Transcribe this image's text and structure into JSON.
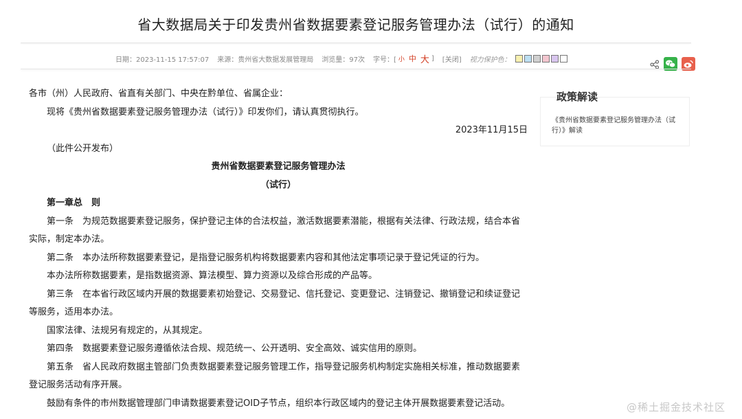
{
  "page": {
    "title": "省大数据局关于印发贵州省数据要素登记服务管理办法（试行）的通知"
  },
  "meta": {
    "date": "日期：2023-11-15 17:57:07",
    "source": "来源：贵州省大数据发展管理局",
    "views": "浏览量：97次",
    "font_size_label": "字号：[",
    "font_small": "小",
    "font_mid": "中",
    "font_big": "大",
    "font_close_bracket": "]",
    "close": "[关闭]",
    "vision_label": "视力保护色：",
    "swatch_colors": [
      "#f7f0b0",
      "#bcdff2",
      "#d0d0d0",
      "#f3c6cf",
      "#d9c6ef",
      "#ffffff"
    ]
  },
  "share": {
    "icons": [
      "share-icon",
      "wechat-icon",
      "weibo-icon"
    ],
    "colors": {
      "wechat": "#36b24a",
      "weibo": "#e8604c"
    }
  },
  "article": {
    "salutation": "各市（州）人民政府、省直有关部门、中央在黔单位、省属企业：",
    "intro": "现将《贵州省数据要素登记服务管理办法（试行）》印发你们，请认真贯彻执行。",
    "date": "2023年11月15日",
    "publish_note": "（此件公开发布）",
    "doc_title": "贵州省数据要素登记服务管理办法",
    "doc_subtitle": "（试行）",
    "chapter1": "第一章总　则",
    "art1": "第一条　为规范数据要素登记服务，保护登记主体的合法权益，激活数据要素潜能，根据有关法律、行政法规，结合本省实际，制定本办法。",
    "art2": "第二条　本办法所称数据要素登记，是指登记服务机构将数据要素内容和其他法定事项记录于登记凭证的行为。",
    "art2b": "本办法所称数据要素，是指数据资源、算法模型、算力资源以及综合形成的产品等。",
    "art3": "第三条　在本省行政区域内开展的数据要素初始登记、交易登记、信托登记、变更登记、注销登记、撤销登记和续证登记等服务，适用本办法。",
    "art3b": "国家法律、法规另有规定的，从其规定。",
    "art4": "第四条　数据要素登记服务遵循依法合规、规范统一、公开透明、安全高效、诚实信用的原则。",
    "art5": "第五条　省人民政府数据主管部门负责数据要素登记服务管理工作，指导登记服务机构制定实施相关标准，推动数据要素登记服务活动有序开展。",
    "art5b": "鼓励有条件的市州数据管理部门申请数据要素登记OID子节点，组织本行政区域内的登记主体开展数据要素登记活动。"
  },
  "sidebar": {
    "title": "政策解读",
    "link": "《贵州省数据要素登记服务管理办法（试行）》解读"
  },
  "watermark": "@稀土掘金技术社区"
}
